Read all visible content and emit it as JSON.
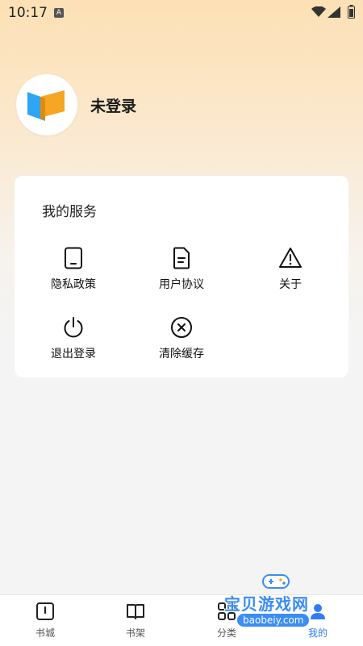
{
  "status": {
    "time": "10:17",
    "notif_letter": "A"
  },
  "profile": {
    "name": "未登录",
    "avatar_icon": "book-logo-icon"
  },
  "services": {
    "title": "我的服务",
    "items": [
      {
        "label": "隐私政策",
        "icon": "tablet-icon"
      },
      {
        "label": "用户协议",
        "icon": "document-icon"
      },
      {
        "label": "关于",
        "icon": "warning-icon"
      },
      {
        "label": "退出登录",
        "icon": "power-icon"
      },
      {
        "label": "清除缓存",
        "icon": "close-circle-icon"
      }
    ]
  },
  "tabs": [
    {
      "label": "书城",
      "icon": "bookstore-icon"
    },
    {
      "label": "书架",
      "icon": "bookshelf-icon"
    },
    {
      "label": "分类",
      "icon": "category-icon"
    },
    {
      "label": "我的",
      "icon": "profile-icon",
      "active": true
    }
  ],
  "watermark": {
    "text": "宝贝游戏网",
    "url": "baobeiy.com"
  },
  "colors": {
    "accent": "#2f7cf6",
    "header_gradient": "#fde0b4"
  }
}
